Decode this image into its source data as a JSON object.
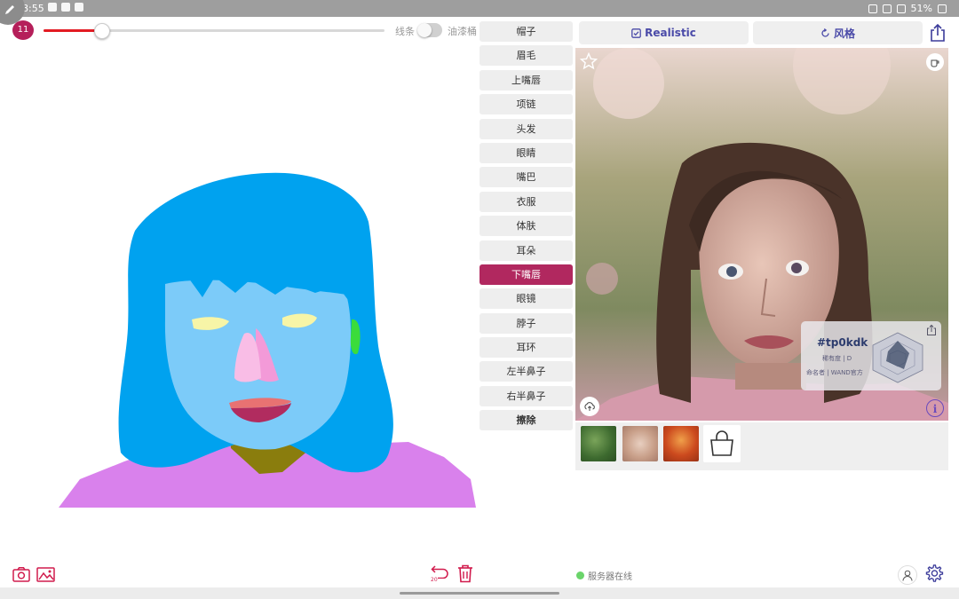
{
  "status_bar": {
    "time": "18:55",
    "battery": "51%"
  },
  "toolbar": {
    "brush_size": "11",
    "brush_fill_fraction": 0.17,
    "lines_label": "线条",
    "paint_bucket_label": "油漆桶"
  },
  "parts": [
    {
      "label": "帽子",
      "active": false
    },
    {
      "label": "眉毛",
      "active": false
    },
    {
      "label": "上嘴唇",
      "active": false
    },
    {
      "label": "项链",
      "active": false
    },
    {
      "label": "头发",
      "active": false
    },
    {
      "label": "眼睛",
      "active": false
    },
    {
      "label": "嘴巴",
      "active": false
    },
    {
      "label": "衣服",
      "active": false
    },
    {
      "label": "体肤",
      "active": false
    },
    {
      "label": "耳朵",
      "active": false
    },
    {
      "label": "下嘴唇",
      "active": true
    },
    {
      "label": "眼镜",
      "active": false
    },
    {
      "label": "脖子",
      "active": false
    },
    {
      "label": "耳环",
      "active": false
    },
    {
      "label": "左半鼻子",
      "active": false
    },
    {
      "label": "右半鼻子",
      "active": false
    },
    {
      "label": "擦除",
      "active": false
    }
  ],
  "mode_buttons": {
    "realistic": "Realistic",
    "style": "风格"
  },
  "result_card": {
    "id": "#tp0kdk",
    "rarity": "稀有度 | D",
    "namer": "命名者 | WAND官方"
  },
  "bottom": {
    "undo_count": "20",
    "server_status": "服务器在线"
  },
  "colors": {
    "accent": "#b1285f",
    "slider_fill": "#e31b23",
    "hair": "#00a2ef",
    "skin": "#7ccbf9",
    "clothes": "#d981ec",
    "neck": "#8a7d0d",
    "server_online": "#6ad46a"
  },
  "icons": [
    "pen-icon",
    "star-icon",
    "cup-icon",
    "upload-icon",
    "info-icon",
    "share-icon",
    "camera-icon",
    "image-icon",
    "undo-icon",
    "trash-icon",
    "user-icon",
    "gear-icon",
    "bag-icon",
    "refresh-icon",
    "checkbox-icon"
  ]
}
